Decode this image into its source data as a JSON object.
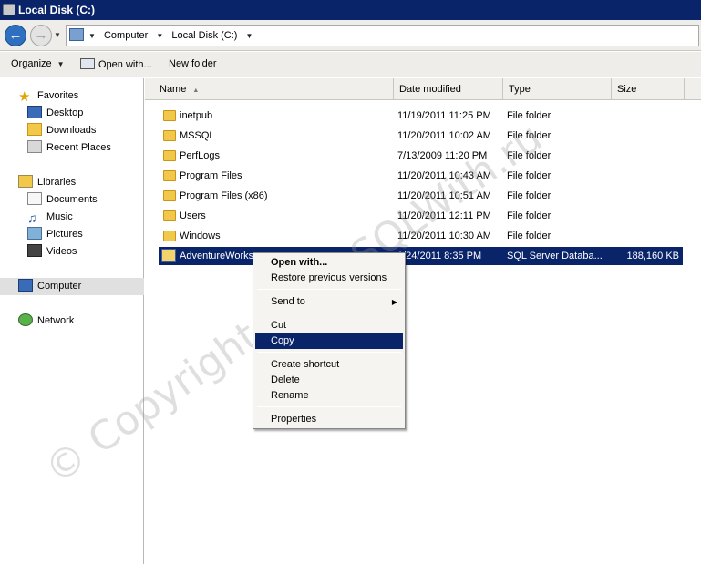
{
  "window": {
    "title": "Local Disk (C:)"
  },
  "address": {
    "crumbs": [
      "Computer",
      "Local Disk (C:)"
    ]
  },
  "toolbar": {
    "organize": "Organize",
    "open_with": "Open with...",
    "new_folder": "New folder"
  },
  "nav": {
    "favorites": {
      "label": "Favorites",
      "items": [
        "Desktop",
        "Downloads",
        "Recent Places"
      ]
    },
    "libraries": {
      "label": "Libraries",
      "items": [
        "Documents",
        "Music",
        "Pictures",
        "Videos"
      ]
    },
    "computer": "Computer",
    "network": "Network"
  },
  "columns": {
    "name": "Name",
    "date": "Date modified",
    "type": "Type",
    "size": "Size"
  },
  "files": [
    {
      "name": "inetpub",
      "date": "11/19/2011 11:25 PM",
      "type": "File folder",
      "size": ""
    },
    {
      "name": "MSSQL",
      "date": "11/20/2011 10:02 AM",
      "type": "File folder",
      "size": ""
    },
    {
      "name": "PerfLogs",
      "date": "7/13/2009 11:20 PM",
      "type": "File folder",
      "size": ""
    },
    {
      "name": "Program Files",
      "date": "11/20/2011 10:43 AM",
      "type": "File folder",
      "size": ""
    },
    {
      "name": "Program Files (x86)",
      "date": "11/20/2011 10:51 AM",
      "type": "File folder",
      "size": ""
    },
    {
      "name": "Users",
      "date": "11/20/2011 12:11 PM",
      "type": "File folder",
      "size": ""
    },
    {
      "name": "Windows",
      "date": "11/20/2011 10:30 AM",
      "type": "File folder",
      "size": ""
    },
    {
      "name": "AdventureWorks",
      "date": "1/24/2011 8:35 PM",
      "type": "SQL Server Databa...",
      "size": "188,160 KB"
    }
  ],
  "context_menu": {
    "open_with": "Open with...",
    "restore": "Restore previous versions",
    "send_to": "Send to",
    "cut": "Cut",
    "copy": "Copy",
    "create_shortcut": "Create shortcut",
    "delete": "Delete",
    "rename": "Rename",
    "properties": "Properties"
  },
  "watermark": "© Copyright LearnSQLWith.ru",
  "colors": {
    "selection": "#0a246a",
    "title_bar": "#0a246a"
  }
}
